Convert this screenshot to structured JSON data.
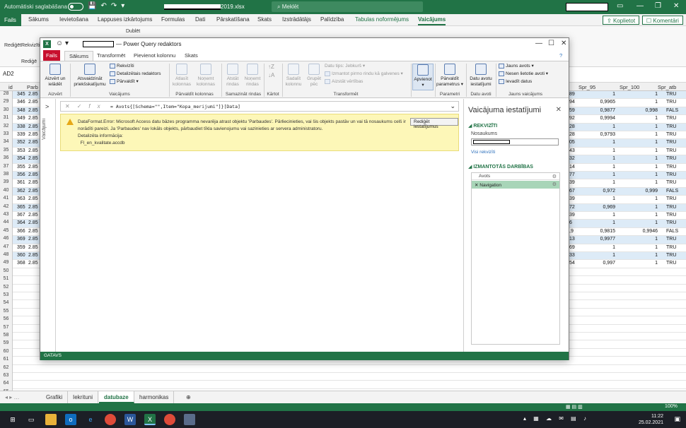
{
  "excel": {
    "autosave": "Automātiski saglabāšana",
    "filename_suffix": "2019.xlsx",
    "search": "Meklēt",
    "tabs": [
      "Sākums",
      "Ievietošana",
      "Lappuses izkārtojums",
      "Formulas",
      "Dati",
      "Pārskatīšana",
      "Skats",
      "Izstrādātājs",
      "Palīdzība",
      "Tabulas noformējums",
      "Vaicājums"
    ],
    "file_tab": "Fails",
    "share": "Koplietot",
    "comments": "Komentāri",
    "ribbon_labels": [
      "Rediģēt",
      "Rekvizīti",
      "Rediģē",
      "Dublēt"
    ],
    "namebox": "AD2",
    "col_headers": [
      "id",
      "Parb",
      "Spr_95",
      "Spr_100",
      "Spr_atb"
    ],
    "rows": [
      {
        "n": "28",
        "a": "345",
        "b": "2.85",
        "c": "89",
        "d": "1",
        "e": "1",
        "f": "TRU",
        "band": true
      },
      {
        "n": "29",
        "a": "346",
        "b": "2.85",
        "c": "94",
        "d": "0,9965",
        "e": "1",
        "f": "TRU",
        "band": false
      },
      {
        "n": "30",
        "a": "348",
        "b": "2.85",
        "c": "59",
        "d": "0,9877",
        "e": "0,998",
        "f": "FALS",
        "band": true
      },
      {
        "n": "31",
        "a": "349",
        "b": "2.85",
        "c": "92",
        "d": "0,9994",
        "e": "1",
        "f": "TRU",
        "band": false
      },
      {
        "n": "32",
        "a": "338",
        "b": "2.85",
        "c": "28",
        "d": "1",
        "e": "1",
        "f": "TRU",
        "band": true
      },
      {
        "n": "33",
        "a": "339",
        "b": "2.85",
        "c": "28",
        "d": "0,9793",
        "e": "1",
        "f": "TRU",
        "band": false
      },
      {
        "n": "34",
        "a": "352",
        "b": "2.85",
        "c": "05",
        "d": "1",
        "e": "1",
        "f": "TRU",
        "band": true
      },
      {
        "n": "35",
        "a": "353",
        "b": "2.85",
        "c": "43",
        "d": "1",
        "e": "1",
        "f": "TRU",
        "band": false
      },
      {
        "n": "36",
        "a": "354",
        "b": "2.85",
        "c": "32",
        "d": "1",
        "e": "1",
        "f": "TRU",
        "band": true
      },
      {
        "n": "37",
        "a": "355",
        "b": "2.85",
        "c": "14",
        "d": "1",
        "e": "1",
        "f": "TRU",
        "band": false
      },
      {
        "n": "38",
        "a": "356",
        "b": "2.85",
        "c": "77",
        "d": "1",
        "e": "1",
        "f": "TRU",
        "band": true
      },
      {
        "n": "39",
        "a": "361",
        "b": "2.85",
        "c": "39",
        "d": "1",
        "e": "1",
        "f": "TRU",
        "band": false
      },
      {
        "n": "40",
        "a": "362",
        "b": "2.85",
        "c": "67",
        "d": "0,972",
        "e": "0,999",
        "f": "FALS",
        "band": true
      },
      {
        "n": "41",
        "a": "363",
        "b": "2.85",
        "c": "39",
        "d": "1",
        "e": "1",
        "f": "TRU",
        "band": false
      },
      {
        "n": "42",
        "a": "365",
        "b": "2.85",
        "c": "72",
        "d": "0,969",
        "e": "1",
        "f": "TRU",
        "band": true
      },
      {
        "n": "43",
        "a": "367",
        "b": "2.85",
        "c": "39",
        "d": "1",
        "e": "1",
        "f": "TRU",
        "band": false
      },
      {
        "n": "44",
        "a": "364",
        "b": "2.85",
        "c": "6",
        "d": "1",
        "e": "1",
        "f": "TRU",
        "band": true
      },
      {
        "n": "45",
        "a": "366",
        "b": "2.85",
        "c": ",9",
        "d": "0,9815",
        "e": "0,9946",
        "f": "FALS",
        "band": false
      },
      {
        "n": "46",
        "a": "369",
        "b": "2.85",
        "c": "13",
        "d": "0,9977",
        "e": "1",
        "f": "TRU",
        "band": true
      },
      {
        "n": "47",
        "a": "359",
        "b": "2.85",
        "c": "69",
        "d": "1",
        "e": "1",
        "f": "TRU",
        "band": false
      },
      {
        "n": "48",
        "a": "360",
        "b": "2.85",
        "c": "33",
        "d": "1",
        "e": "1",
        "f": "TRU",
        "band": true
      },
      {
        "n": "49",
        "a": "368",
        "b": "2.85",
        "c": "54",
        "d": "0,997",
        "e": "1",
        "f": "TRU",
        "band": false
      }
    ],
    "empty_rows": [
      "50",
      "51",
      "52",
      "53",
      "54",
      "55",
      "56",
      "57",
      "58",
      "59",
      "60",
      "61",
      "62",
      "63",
      "64",
      "65"
    ],
    "sheets": [
      "Grafiki",
      "Iekrituni",
      "datubaze",
      "harmonikas"
    ],
    "active_sheet": "datubaze",
    "zoom": "100%",
    "clock_time": "11:22",
    "clock_date": "25.02.2021"
  },
  "pq": {
    "title": "— Power Query redaktors",
    "tabs": {
      "file": "Fails",
      "home": "Sākums",
      "transform": "Transformēt",
      "addcol": "Pievienot kolonnu",
      "view": "Skats"
    },
    "ribbon": {
      "close_load": "Aizvērt un ielādēt",
      "refresh": "Atsvaidzināt priekšskatījumu",
      "properties": "Rekvizīti",
      "advanced": "Detalizētais redaktors",
      "manage": "Pārvaldīt",
      "choose_cols": "Atlasīt kolonnas",
      "remove_cols": "Noņemt kolonnas",
      "keep_rows": "Atstāt rindas",
      "remove_rows": "Noņemt rindas",
      "split_col": "Sadalīt kolonnu",
      "group_by": "Grupēt pēc",
      "data_type": "Datu tips: Jebkurš",
      "first_row": "Izmantot pirmo rindu kā galvenes",
      "replace": "Aizstāt vērtības",
      "combine": "Apvienot",
      "params": "Pārvaldīt parametrus",
      "ds_settings": "Datu avotu iestatījumi",
      "new_source": "Jauns avots",
      "recent": "Nesen lietotie avoti",
      "enter_data": "Ievadīt datus",
      "groups": {
        "close": "Aizvērt",
        "query": "Vaicājums",
        "manage_cols": "Pārvaldīt kolonnas",
        "reduce": "Samazināt rindas",
        "sort": "Kārtot",
        "transform": "Transformēt",
        "params": "Parametri",
        "datasrc": "Datu avoti",
        "newq": "Jauns vaicājums"
      }
    },
    "side_label": "Vaicājumi",
    "formula": "= Avots{[Schema=\"\",Item=\"Kopa_merijumi\"]}[Data]",
    "error": {
      "message": "DataFormat.Error: Microsoft Access datu bāzes programma nevarēja atrast objektu 'Parbaudes'. Pārliecinieties, vai šis objekts pastāv un vai tā nosaukums celš ir norādīti pareizi. Ja 'Parbaudes' nav lokāls objekts, pārbaudiet tīkla savienojumu vai sazinieties ar servera administratoru.",
      "details_label": "Detalizēta informācija:",
      "details_value": "Fl_en_kvalitate.accdb",
      "button": "Rediģēt iestatījumus"
    },
    "settings": {
      "title": "Vaicājuma iestatījumi",
      "props_section": "REKVIZĪTI",
      "name_label": "Nosaukums",
      "all_props": "Visi rekvizīti",
      "steps_section": "IZMANTOTĀS DARBĪBAS",
      "steps": [
        "Avots",
        "Navigation"
      ]
    },
    "status": "GATAVS"
  }
}
